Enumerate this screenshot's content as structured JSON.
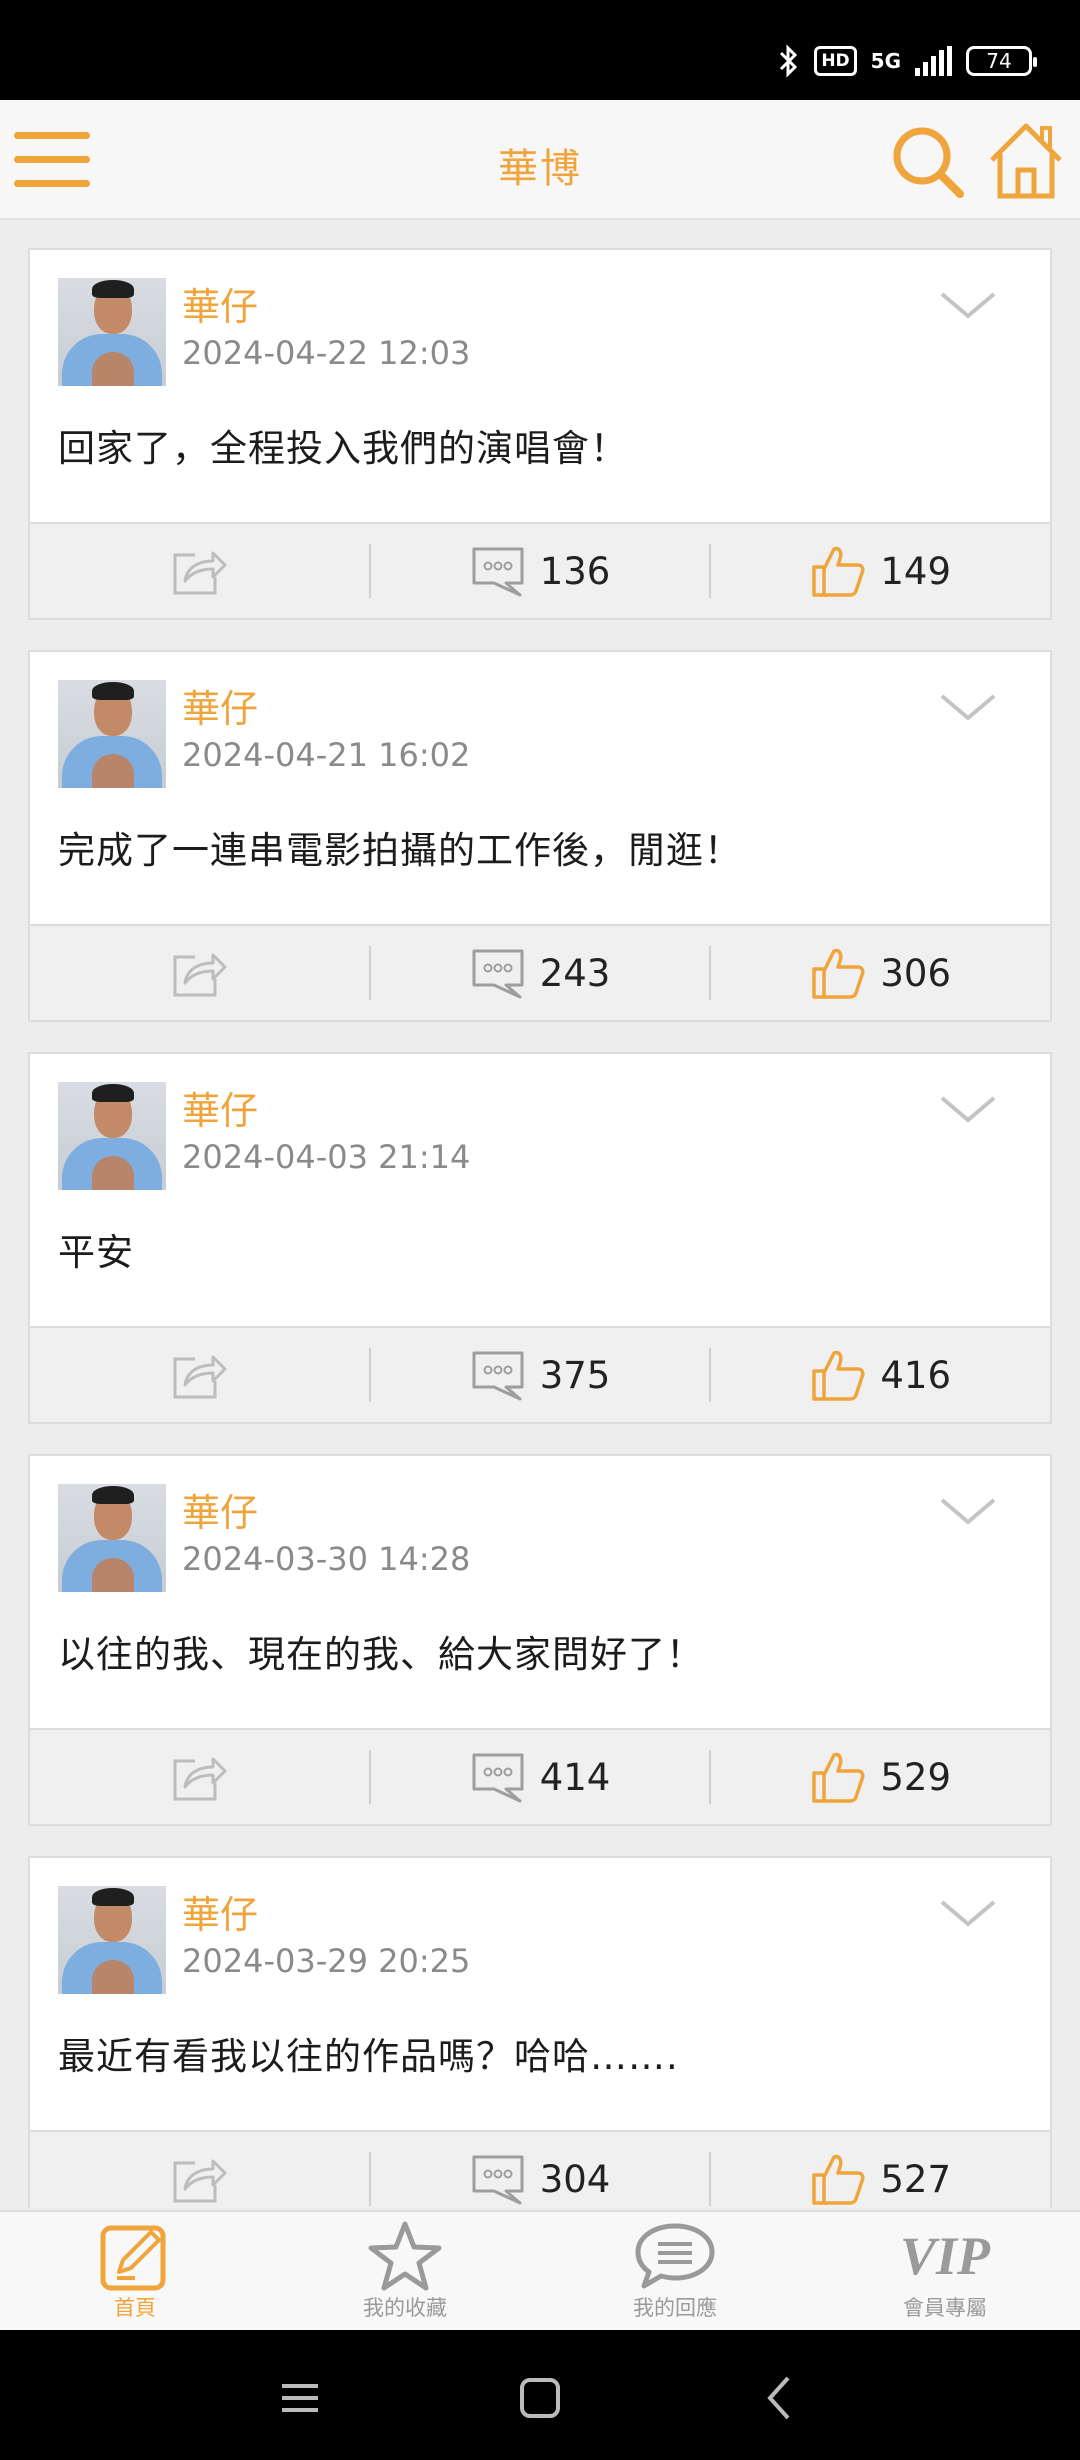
{
  "status_bar": {
    "net": "5G",
    "hd": "HD",
    "battery": "74"
  },
  "app": {
    "title": "華博"
  },
  "posts": [
    {
      "author": "華仔",
      "time": "2024-04-22 12:03",
      "content": "回家了，全程投入我們的演唱會！",
      "comments": "136",
      "likes": "149"
    },
    {
      "author": "華仔",
      "time": "2024-04-21 16:02",
      "content": "完成了一連串電影拍攝的工作後，閒逛！",
      "comments": "243",
      "likes": "306"
    },
    {
      "author": "華仔",
      "time": "2024-04-03 21:14",
      "content": "平安",
      "comments": "375",
      "likes": "416"
    },
    {
      "author": "華仔",
      "time": "2024-03-30 14:28",
      "content": "以往的我、現在的我、給大家問好了！",
      "comments": "414",
      "likes": "529"
    },
    {
      "author": "華仔",
      "time": "2024-03-29 20:25",
      "content": "最近有看我以往的作品嗎？哈哈…….",
      "comments": "304",
      "likes": "527"
    }
  ],
  "tabs": [
    {
      "label": "首頁",
      "icon": "edit-icon",
      "active": true
    },
    {
      "label": "我的收藏",
      "icon": "star-icon",
      "active": false
    },
    {
      "label": "我的回應",
      "icon": "speech-bubble-icon",
      "active": false
    },
    {
      "label": "會員專屬",
      "icon": "vip-icon",
      "active": false
    }
  ],
  "colors": {
    "accent": "#f0a43c",
    "muted": "#9a9a9a",
    "background": "#ededed"
  }
}
